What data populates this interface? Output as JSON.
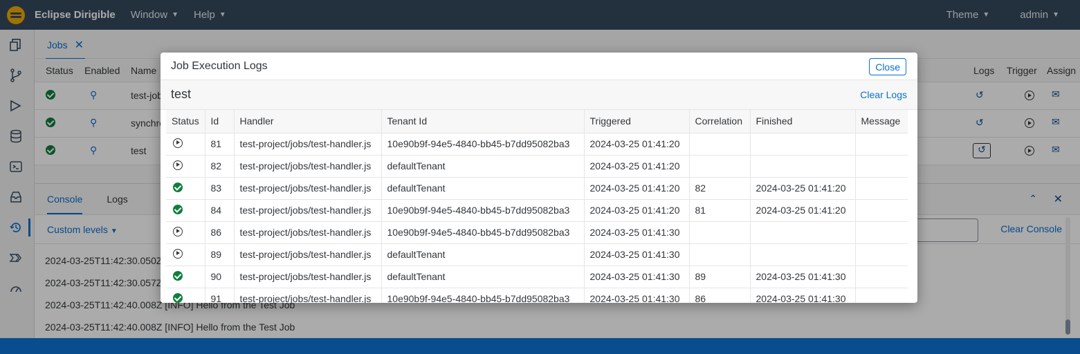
{
  "shell": {
    "brand": "Eclipse Dirigible",
    "menus": [
      {
        "label": "Window"
      },
      {
        "label": "Help"
      }
    ],
    "right_menus": [
      {
        "label": "Theme"
      },
      {
        "label": "admin"
      }
    ]
  },
  "jobs_panel": {
    "tab_label": "Jobs",
    "headers": {
      "status": "Status",
      "enabled": "Enabled",
      "name": "Name",
      "logs": "Logs",
      "trigger": "Trigger",
      "assign": "Assign"
    },
    "rows": [
      {
        "name": "test-job"
      },
      {
        "name": "synchro"
      },
      {
        "name": "test"
      }
    ]
  },
  "console_panel": {
    "tabs": [
      {
        "label": "Console"
      },
      {
        "label": "Logs"
      }
    ],
    "custom_levels": "Custom levels",
    "clear_console": "Clear Console",
    "lines": [
      "2024-03-25T11:42:30.050Z",
      "2024-03-25T11:42:30.057Z",
      "2024-03-25T11:42:40.008Z [INFO] Hello from the Test Job",
      "2024-03-25T11:42:40.008Z [INFO] Hello from the Test Job"
    ]
  },
  "dialog": {
    "title": "Job Execution Logs",
    "close_label": "Close",
    "job_name": "test",
    "clear_logs_label": "Clear Logs",
    "columns": {
      "status": "Status",
      "id": "Id",
      "handler": "Handler",
      "tenant": "Tenant Id",
      "triggered": "Triggered",
      "correlation": "Correlation",
      "finished": "Finished",
      "message": "Message"
    },
    "rows": [
      {
        "status": "triggered",
        "id": "81",
        "handler": "test-project/jobs/test-handler.js",
        "tenant": "10e90b9f-94e5-4840-bb45-b7dd95082ba3",
        "triggered": "2024-03-25 01:41:20",
        "correlation": "",
        "finished": "",
        "message": ""
      },
      {
        "status": "triggered",
        "id": "82",
        "handler": "test-project/jobs/test-handler.js",
        "tenant": "defaultTenant",
        "triggered": "2024-03-25 01:41:20",
        "correlation": "",
        "finished": "",
        "message": ""
      },
      {
        "status": "finished",
        "id": "83",
        "handler": "test-project/jobs/test-handler.js",
        "tenant": "defaultTenant",
        "triggered": "2024-03-25 01:41:20",
        "correlation": "82",
        "finished": "2024-03-25 01:41:20",
        "message": ""
      },
      {
        "status": "finished",
        "id": "84",
        "handler": "test-project/jobs/test-handler.js",
        "tenant": "10e90b9f-94e5-4840-bb45-b7dd95082ba3",
        "triggered": "2024-03-25 01:41:20",
        "correlation": "81",
        "finished": "2024-03-25 01:41:20",
        "message": ""
      },
      {
        "status": "triggered",
        "id": "86",
        "handler": "test-project/jobs/test-handler.js",
        "tenant": "10e90b9f-94e5-4840-bb45-b7dd95082ba3",
        "triggered": "2024-03-25 01:41:30",
        "correlation": "",
        "finished": "",
        "message": ""
      },
      {
        "status": "triggered",
        "id": "89",
        "handler": "test-project/jobs/test-handler.js",
        "tenant": "defaultTenant",
        "triggered": "2024-03-25 01:41:30",
        "correlation": "",
        "finished": "",
        "message": ""
      },
      {
        "status": "finished",
        "id": "90",
        "handler": "test-project/jobs/test-handler.js",
        "tenant": "defaultTenant",
        "triggered": "2024-03-25 01:41:30",
        "correlation": "89",
        "finished": "2024-03-25 01:41:30",
        "message": ""
      },
      {
        "status": "finished",
        "id": "91",
        "handler": "test-project/jobs/test-handler.js",
        "tenant": "10e90b9f-94e5-4840-bb45-b7dd95082ba3",
        "triggered": "2024-03-25 01:41:30",
        "correlation": "86",
        "finished": "2024-03-25 01:41:30",
        "message": ""
      }
    ]
  },
  "colors": {
    "shell": "#354a5f",
    "accent": "#0a6ed1",
    "success": "#107e3e",
    "footer": "#0a4d8e"
  }
}
